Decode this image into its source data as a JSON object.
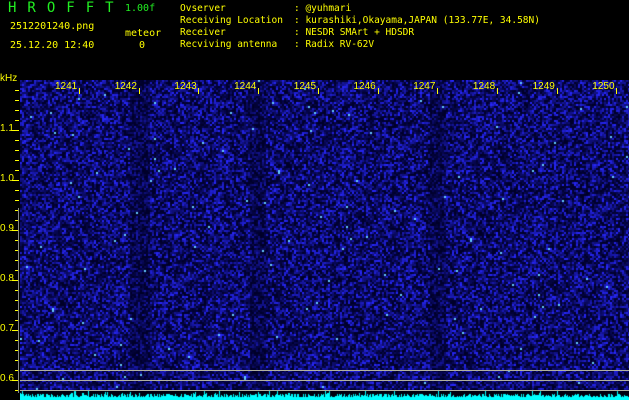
{
  "header": {
    "title": "HROFFT",
    "version": "1.00f",
    "filename": "2512201240.png",
    "datetime": "25.12.20 12:40",
    "meteor_label": "meteor",
    "meteor_count": "0"
  },
  "info": [
    {
      "label": "Ovserver",
      "value": "@yuhmari"
    },
    {
      "label": "Receiving Location",
      "value": "kurashiki,Okayama,JAPAN (133.77E, 34.58N)"
    },
    {
      "label": "Receiver",
      "value": "NESDR SMArt + HDSDR"
    },
    {
      "label": "Recviving antenna",
      "value": "Radix RV-62V"
    }
  ],
  "axis": {
    "y_unit": "kHz",
    "y_ticks": [
      "1.1",
      "1.0",
      "0.9",
      "0.8",
      "0.7",
      "0.6"
    ],
    "x_ticks": [
      "1241",
      "1242",
      "1243",
      "1244",
      "1245",
      "1246",
      "1247",
      "1248",
      "1249",
      "1250"
    ]
  },
  "colors": {
    "noise": "#1a1acc",
    "spectrum": "#00ffff",
    "text": "#ffff00",
    "title": "#22ee22"
  }
}
